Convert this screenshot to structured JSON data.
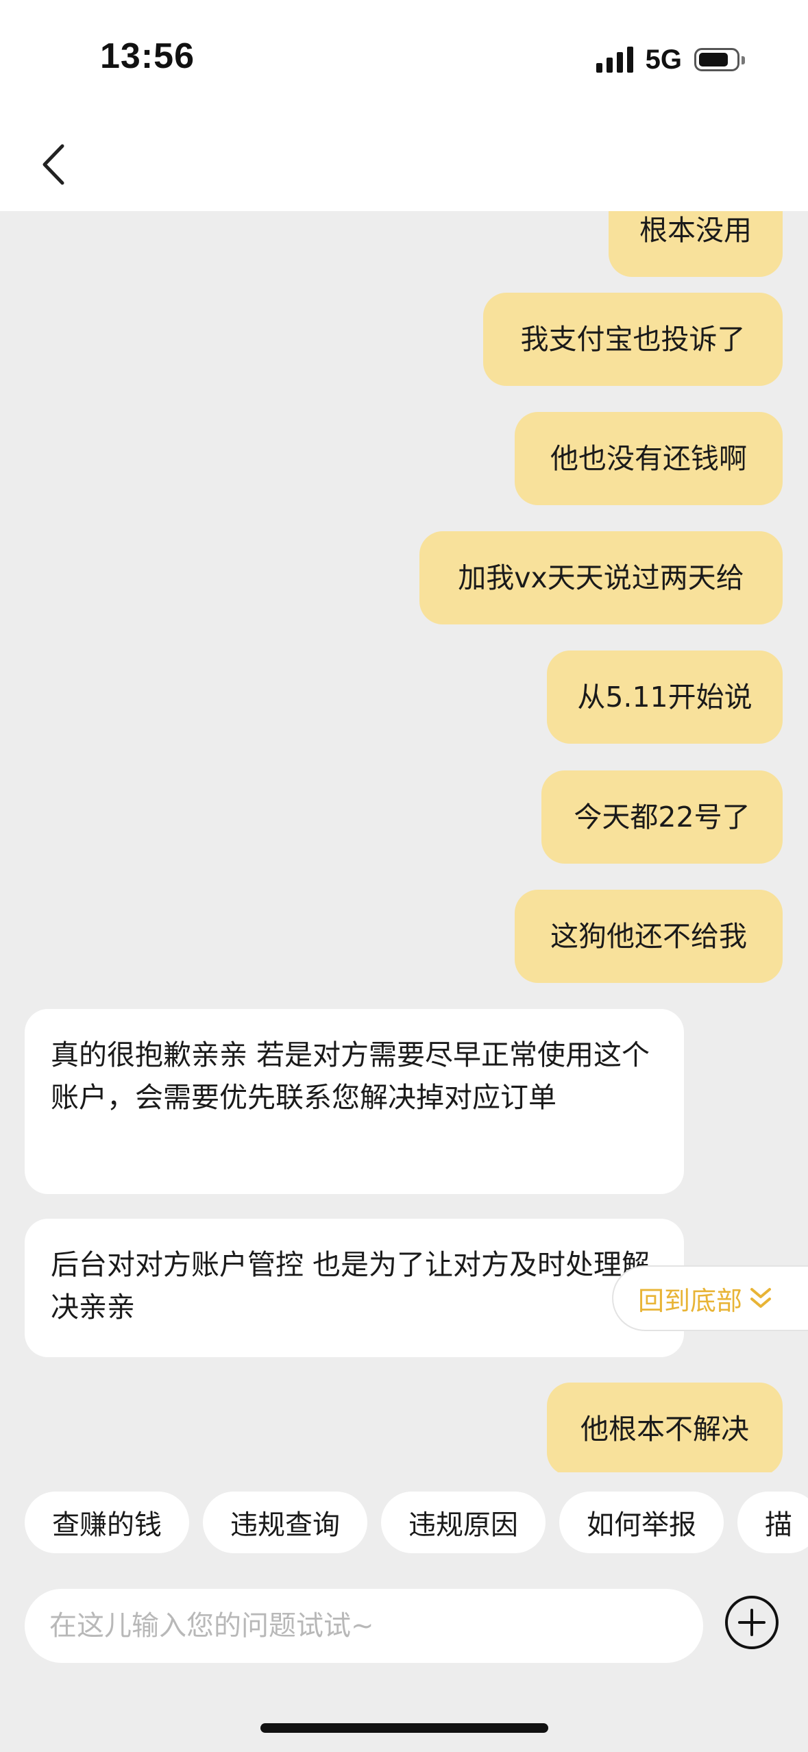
{
  "status_bar": {
    "time": "13:56",
    "network": "5G"
  },
  "messages": [
    {
      "side": "out",
      "text": "根本没用"
    },
    {
      "side": "out",
      "text": "我支付宝也投诉了"
    },
    {
      "side": "out",
      "text": "他也没有还钱啊"
    },
    {
      "side": "out",
      "text": "加我vx天天说过两天给"
    },
    {
      "side": "out",
      "text": "从5.11开始说"
    },
    {
      "side": "out",
      "text": "今天都22号了"
    },
    {
      "side": "out",
      "text": "这狗他还不给我"
    },
    {
      "side": "in",
      "text": "真的很抱歉亲亲  若是对方需要尽早正常使用这个账户，会需要优先联系您解决掉对应订单"
    },
    {
      "side": "in",
      "text": "后台对对方账户管控 也是为了让对方及时处理解决亲亲"
    },
    {
      "side": "out",
      "text": "他根本不解决"
    }
  ],
  "scroll_to_bottom_label": "回到底部",
  "quick_replies": [
    "查赚的钱",
    "违规查询",
    "违规原因",
    "如何举报",
    "描"
  ],
  "input": {
    "placeholder": "在这儿输入您的问题试试~",
    "value": ""
  },
  "colors": {
    "outgoing_bubble": "#f8e19b",
    "incoming_bubble": "#ffffff",
    "accent": "#e8b436",
    "background": "#ededed"
  },
  "icons": {
    "back": "chevron-left-icon",
    "more": "plus-circle-icon",
    "scroll": "double-chevron-down-icon"
  }
}
